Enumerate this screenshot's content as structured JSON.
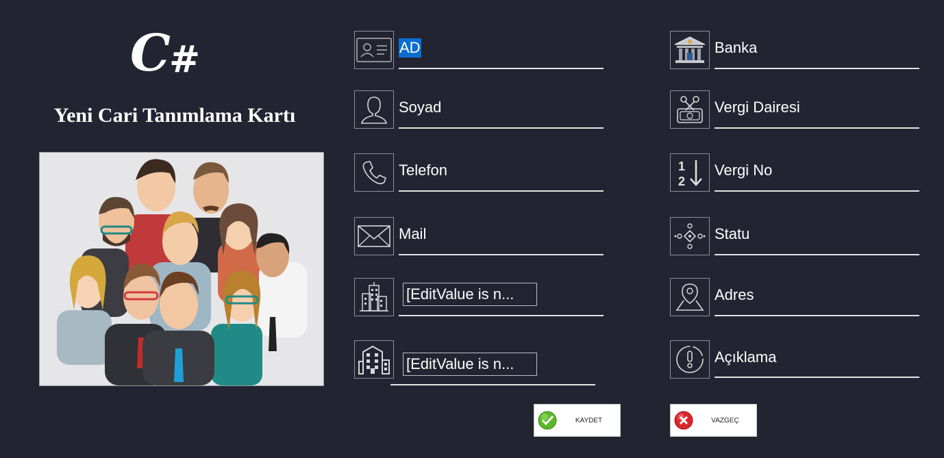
{
  "header": {
    "logo_text": "C",
    "logo_suffix": "#",
    "title": "Yeni Cari Tanımlama Kartı"
  },
  "left_fields": [
    {
      "label": "AD",
      "icon": "id-card-icon",
      "selected": true
    },
    {
      "label": "Soyad",
      "icon": "person-icon"
    },
    {
      "label": "Telefon",
      "icon": "phone-icon"
    },
    {
      "label": "Mail",
      "icon": "envelope-icon"
    },
    {
      "value": "[EditValue is n...",
      "icon": "city-buildings-icon"
    },
    {
      "value": "[EditValue is n...",
      "icon": "apartment-icon"
    }
  ],
  "right_fields": [
    {
      "label": "Banka",
      "icon": "bank-icon"
    },
    {
      "label": "Vergi Dairesi",
      "icon": "tax-office-icon"
    },
    {
      "label": "Vergi No",
      "icon": "sort-numeric-icon"
    },
    {
      "label": "Statu",
      "icon": "status-nodes-icon"
    },
    {
      "label": "Adres",
      "icon": "map-pin-icon"
    },
    {
      "label": "Açıklama",
      "icon": "info-exclamation-icon"
    }
  ],
  "buttons": {
    "save_label": "KAYDET",
    "cancel_label": "VAZGEÇ"
  },
  "colors": {
    "background": "#222431",
    "selection": "#0a6ed1",
    "save_green": "#5cb82a",
    "cancel_red": "#d9262d"
  }
}
